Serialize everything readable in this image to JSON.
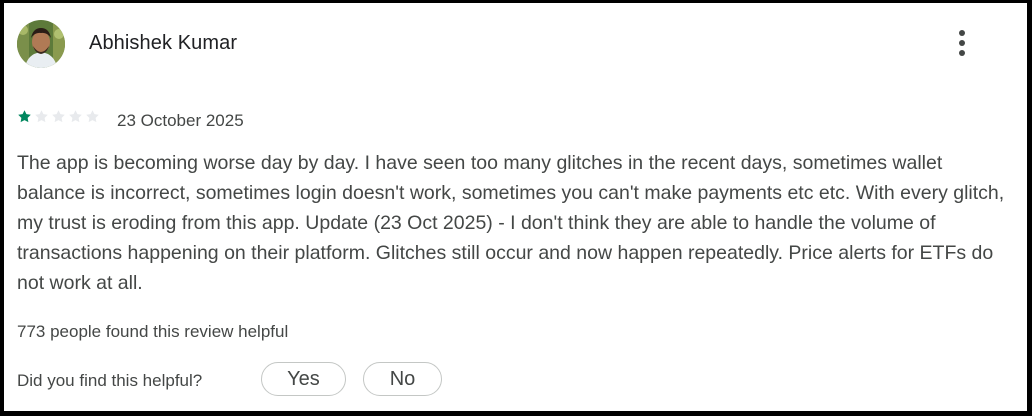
{
  "review": {
    "author": "Abhishek Kumar",
    "rating": 1,
    "max_rating": 5,
    "date": "23 October 2025",
    "text": "The app is becoming worse day by day. I have seen too many glitches in the recent days, sometimes wallet balance is incorrect, sometimes login doesn't work, sometimes you can't make payments etc etc. With every glitch, my trust is eroding from this app. Update (23 Oct 2025) - I don't think they are able to handle the volume of transactions happening on their platform. Glitches still occur and now happen repeatedly. Price alerts for ETFs do not work at all.",
    "helpful_count_text": "773 people found this review helpful"
  },
  "feedback": {
    "question": "Did you find this helpful?",
    "yes_label": "Yes",
    "no_label": "No"
  },
  "icons": {
    "more": "more-vert-icon",
    "star": "star-icon"
  },
  "colors": {
    "star_filled": "#01875f",
    "star_empty": "#e8eaed"
  }
}
